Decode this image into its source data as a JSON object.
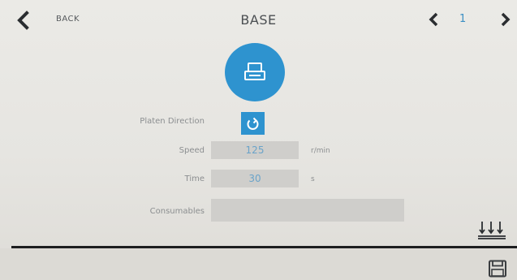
{
  "header": {
    "back_label": "BACK",
    "title": "BASE",
    "page_number": "1"
  },
  "mode": {
    "icon": "platen-icon"
  },
  "form": {
    "platen_direction": {
      "label": "Platen Direction",
      "icon": "rotate-icon"
    },
    "speed": {
      "label": "Speed",
      "value": "125",
      "unit": "r/min"
    },
    "time": {
      "label": "Time",
      "value": "30",
      "unit": "s"
    },
    "consumables": {
      "label": "Consumables",
      "value": ""
    }
  },
  "colors": {
    "accent": "#2e93cf",
    "field_bg": "#cfcecb",
    "field_text": "#6aa3c9",
    "divider": "#1d1e1f"
  }
}
